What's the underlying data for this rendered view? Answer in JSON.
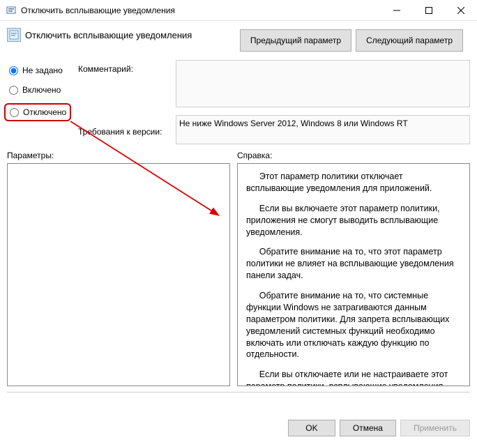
{
  "window": {
    "title": "Отключить всплывающие уведомления"
  },
  "header": {
    "title": "Отключить всплывающие уведомления"
  },
  "nav": {
    "prev": "Предыдущий параметр",
    "next": "Следующий параметр"
  },
  "options": {
    "not_configured": "Не задано",
    "enabled": "Включено",
    "disabled": "Отключено"
  },
  "labels": {
    "comment": "Комментарий:",
    "requirements": "Требования к версии:",
    "params": "Параметры:",
    "help": "Справка:"
  },
  "requirements_text": "Не ниже Windows Server 2012, Windows 8 или Windows RT",
  "help": {
    "p1": "Этот параметр политики отключает всплывающие уведомления для приложений.",
    "p2": "Если вы включаете этот параметр политики, приложения не смогут выводить всплывающие уведомления.",
    "p3": "Обратите внимание на то, что этот параметр политики не влияет на всплывающие уведомления панели задач.",
    "p4": "Обратите внимание на то, что системные функции Windows не затрагиваются данным параметром политики. Для запрета всплывающих уведомлений системных функций необходимо включать или отключать каждую функцию по отдельности.",
    "p5": "Если вы отключаете или не настраиваете этот параметр политики, всплывающие уведомления включены и могут быть отключены администратором или пользователем"
  },
  "footer": {
    "ok": "OK",
    "cancel": "Отмена",
    "apply": "Применить"
  }
}
